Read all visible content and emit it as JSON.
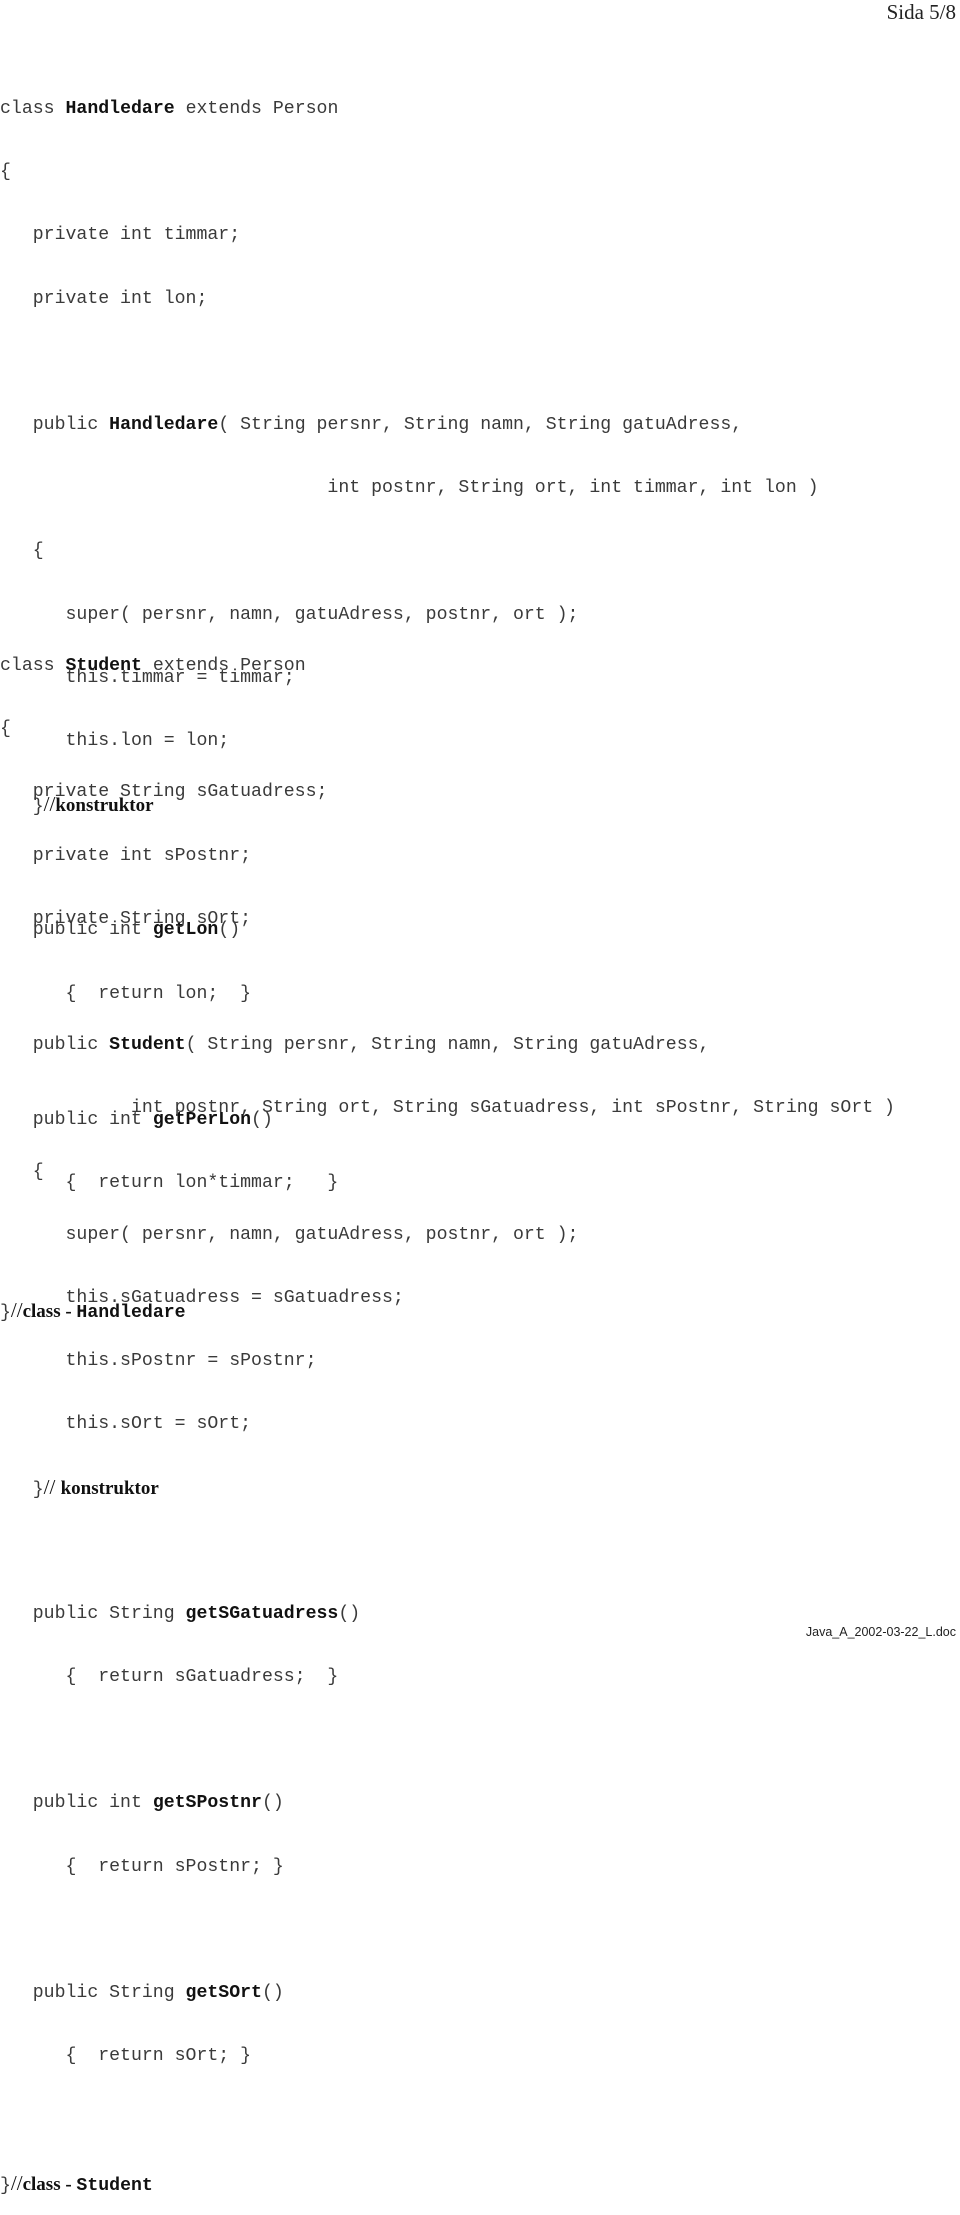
{
  "header": {
    "page_label": "Sida 5/8"
  },
  "footer": {
    "filename": "Java_A_2002-03-22_L.doc"
  },
  "handledare": {
    "l1": {
      "a": "class ",
      "b": "Handledare",
      "c": " extends Person"
    },
    "l2": "{",
    "l3": "   private int timmar;",
    "l4": "   private int lon;",
    "l6": {
      "a": "   public ",
      "b": "Handledare",
      "c": "( String persnr, String namn, String gatuAdress,"
    },
    "l7": "                              int postnr, String ort, int timmar, int lon )",
    "l8": "   {",
    "l9": "      super( persnr, namn, gatuAdress, postnr, ort );",
    "l10": "      this.timmar = timmar;",
    "l11": "      this.lon = lon;",
    "l12": {
      "a": "   }",
      "slash": "//",
      "c": "konstruktor"
    },
    "l14": {
      "a": "   public int ",
      "b": "getLon",
      "c": "()"
    },
    "l15": "      {  return lon;  }",
    "l17": {
      "a": "   public int ",
      "b": "getPerLon",
      "c": "()"
    },
    "l18": "      {  return lon*timmar;   }",
    "l20": {
      "a": "}",
      "slash": "//",
      "c": "class - ",
      "d": "Handledare"
    }
  },
  "student": {
    "l1": {
      "a": "class ",
      "b": "Student",
      "c": " extends Person"
    },
    "l2": "{",
    "l3": "   private String sGatuadress;",
    "l4": "   private int sPostnr;",
    "l5": "   private String sOrt;",
    "l7": {
      "a": "   public ",
      "b": "Student",
      "c": "( String persnr, String namn, String gatuAdress,"
    },
    "l8": "            int postnr, String ort, String sGatuadress, int sPostnr, String sOrt )",
    "l9": "   {",
    "l10": "      super( persnr, namn, gatuAdress, postnr, ort );",
    "l11": "      this.sGatuadress = sGatuadress;",
    "l12": "      this.sPostnr = sPostnr;",
    "l13": "      this.sOrt = sOrt;",
    "l14": {
      "a": "   }",
      "slash": "// ",
      "c": "konstruktor"
    },
    "l16": {
      "a": "   public String ",
      "b": "getSGatuadress",
      "c": "()"
    },
    "l17": "      {  return sGatuadress;  }",
    "l19": {
      "a": "   public int ",
      "b": "getSPostnr",
      "c": "()"
    },
    "l20": "      {  return sPostnr; }",
    "l22": {
      "a": "   public String ",
      "b": "getSOrt",
      "c": "()"
    },
    "l23": "      {  return sOrt; }",
    "l25": {
      "a": "}",
      "slash": "//",
      "c": "class - ",
      "d": "Student"
    }
  }
}
